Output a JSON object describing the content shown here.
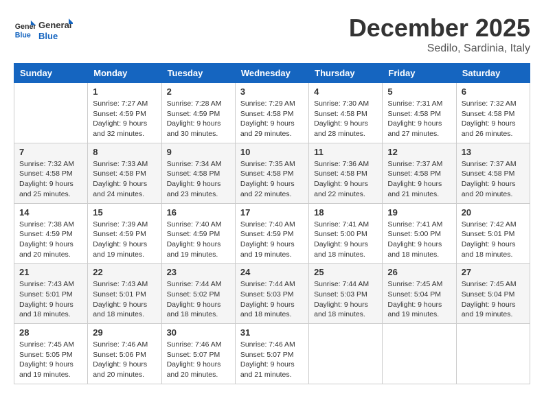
{
  "header": {
    "logo_general": "General",
    "logo_blue": "Blue",
    "month_title": "December 2025",
    "location": "Sedilo, Sardinia, Italy"
  },
  "columns": [
    "Sunday",
    "Monday",
    "Tuesday",
    "Wednesday",
    "Thursday",
    "Friday",
    "Saturday"
  ],
  "weeks": [
    [
      {
        "day": "",
        "info": ""
      },
      {
        "day": "1",
        "info": "Sunrise: 7:27 AM\nSunset: 4:59 PM\nDaylight: 9 hours\nand 32 minutes."
      },
      {
        "day": "2",
        "info": "Sunrise: 7:28 AM\nSunset: 4:59 PM\nDaylight: 9 hours\nand 30 minutes."
      },
      {
        "day": "3",
        "info": "Sunrise: 7:29 AM\nSunset: 4:58 PM\nDaylight: 9 hours\nand 29 minutes."
      },
      {
        "day": "4",
        "info": "Sunrise: 7:30 AM\nSunset: 4:58 PM\nDaylight: 9 hours\nand 28 minutes."
      },
      {
        "day": "5",
        "info": "Sunrise: 7:31 AM\nSunset: 4:58 PM\nDaylight: 9 hours\nand 27 minutes."
      },
      {
        "day": "6",
        "info": "Sunrise: 7:32 AM\nSunset: 4:58 PM\nDaylight: 9 hours\nand 26 minutes."
      }
    ],
    [
      {
        "day": "7",
        "info": "Sunrise: 7:32 AM\nSunset: 4:58 PM\nDaylight: 9 hours\nand 25 minutes."
      },
      {
        "day": "8",
        "info": "Sunrise: 7:33 AM\nSunset: 4:58 PM\nDaylight: 9 hours\nand 24 minutes."
      },
      {
        "day": "9",
        "info": "Sunrise: 7:34 AM\nSunset: 4:58 PM\nDaylight: 9 hours\nand 23 minutes."
      },
      {
        "day": "10",
        "info": "Sunrise: 7:35 AM\nSunset: 4:58 PM\nDaylight: 9 hours\nand 22 minutes."
      },
      {
        "day": "11",
        "info": "Sunrise: 7:36 AM\nSunset: 4:58 PM\nDaylight: 9 hours\nand 22 minutes."
      },
      {
        "day": "12",
        "info": "Sunrise: 7:37 AM\nSunset: 4:58 PM\nDaylight: 9 hours\nand 21 minutes."
      },
      {
        "day": "13",
        "info": "Sunrise: 7:37 AM\nSunset: 4:58 PM\nDaylight: 9 hours\nand 20 minutes."
      }
    ],
    [
      {
        "day": "14",
        "info": "Sunrise: 7:38 AM\nSunset: 4:59 PM\nDaylight: 9 hours\nand 20 minutes."
      },
      {
        "day": "15",
        "info": "Sunrise: 7:39 AM\nSunset: 4:59 PM\nDaylight: 9 hours\nand 19 minutes."
      },
      {
        "day": "16",
        "info": "Sunrise: 7:40 AM\nSunset: 4:59 PM\nDaylight: 9 hours\nand 19 minutes."
      },
      {
        "day": "17",
        "info": "Sunrise: 7:40 AM\nSunset: 4:59 PM\nDaylight: 9 hours\nand 19 minutes."
      },
      {
        "day": "18",
        "info": "Sunrise: 7:41 AM\nSunset: 5:00 PM\nDaylight: 9 hours\nand 18 minutes."
      },
      {
        "day": "19",
        "info": "Sunrise: 7:41 AM\nSunset: 5:00 PM\nDaylight: 9 hours\nand 18 minutes."
      },
      {
        "day": "20",
        "info": "Sunrise: 7:42 AM\nSunset: 5:01 PM\nDaylight: 9 hours\nand 18 minutes."
      }
    ],
    [
      {
        "day": "21",
        "info": "Sunrise: 7:43 AM\nSunset: 5:01 PM\nDaylight: 9 hours\nand 18 minutes."
      },
      {
        "day": "22",
        "info": "Sunrise: 7:43 AM\nSunset: 5:01 PM\nDaylight: 9 hours\nand 18 minutes."
      },
      {
        "day": "23",
        "info": "Sunrise: 7:44 AM\nSunset: 5:02 PM\nDaylight: 9 hours\nand 18 minutes."
      },
      {
        "day": "24",
        "info": "Sunrise: 7:44 AM\nSunset: 5:03 PM\nDaylight: 9 hours\nand 18 minutes."
      },
      {
        "day": "25",
        "info": "Sunrise: 7:44 AM\nSunset: 5:03 PM\nDaylight: 9 hours\nand 18 minutes."
      },
      {
        "day": "26",
        "info": "Sunrise: 7:45 AM\nSunset: 5:04 PM\nDaylight: 9 hours\nand 19 minutes."
      },
      {
        "day": "27",
        "info": "Sunrise: 7:45 AM\nSunset: 5:04 PM\nDaylight: 9 hours\nand 19 minutes."
      }
    ],
    [
      {
        "day": "28",
        "info": "Sunrise: 7:45 AM\nSunset: 5:05 PM\nDaylight: 9 hours\nand 19 minutes."
      },
      {
        "day": "29",
        "info": "Sunrise: 7:46 AM\nSunset: 5:06 PM\nDaylight: 9 hours\nand 20 minutes."
      },
      {
        "day": "30",
        "info": "Sunrise: 7:46 AM\nSunset: 5:07 PM\nDaylight: 9 hours\nand 20 minutes."
      },
      {
        "day": "31",
        "info": "Sunrise: 7:46 AM\nSunset: 5:07 PM\nDaylight: 9 hours\nand 21 minutes."
      },
      {
        "day": "",
        "info": ""
      },
      {
        "day": "",
        "info": ""
      },
      {
        "day": "",
        "info": ""
      }
    ]
  ]
}
